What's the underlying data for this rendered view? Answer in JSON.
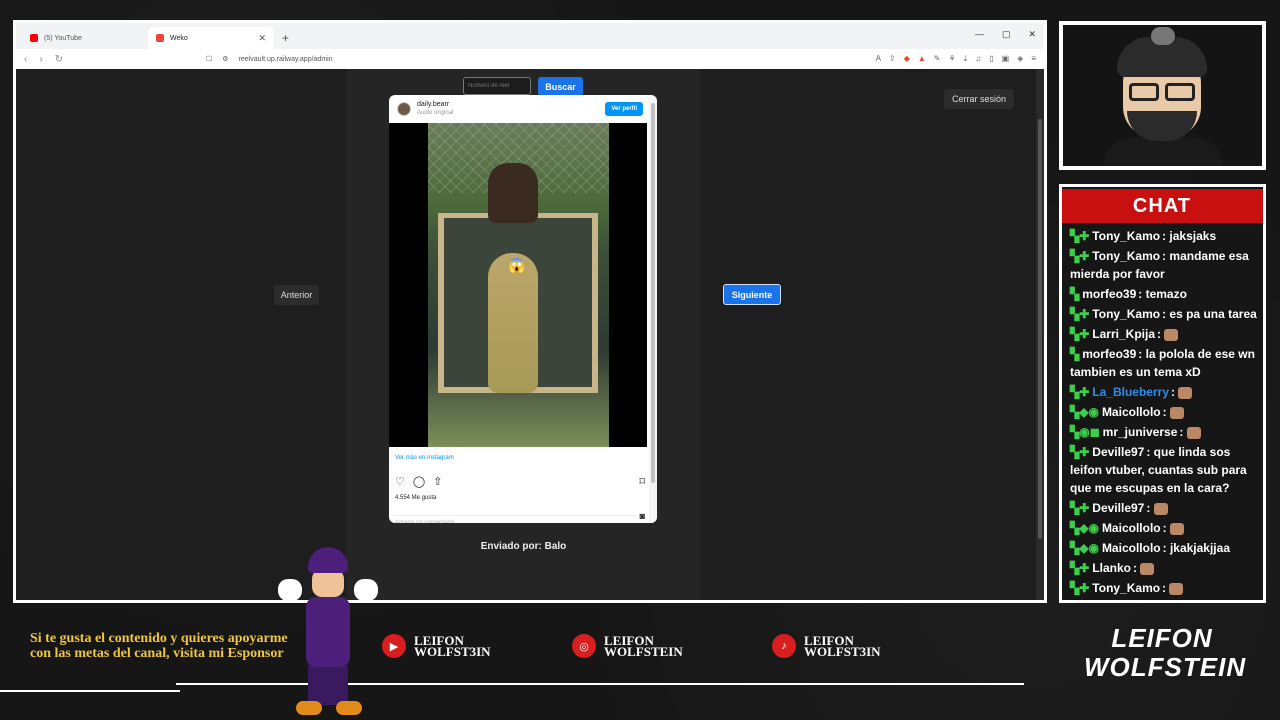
{
  "browser": {
    "tabs": [
      {
        "label": "(5) YouTube",
        "icon": "youtube-icon",
        "color": "#ff0000"
      },
      {
        "label": "Weko",
        "icon": "weko-icon",
        "color": "#e44"
      }
    ],
    "url": "reelvault.up.railway.app/admin"
  },
  "app": {
    "reel_input_placeholder": "Número de reel",
    "search_label": "Buscar",
    "logout_label": "Cerrar sesión",
    "prev_label": "Anterior",
    "next_label": "Siguiente",
    "sent_by": "Enviado por: Balo"
  },
  "instagram": {
    "username": "daily.bearr",
    "subtitle": "Audio original",
    "view_profile": "Ver perfil",
    "view_more": "Ver más en Instagram",
    "likes": "4.554 Me gusta",
    "comment_placeholder": "Agrega un comentario..."
  },
  "chat": {
    "title": "CHAT",
    "messages": [
      {
        "user": "Tony_Kamo",
        "color": "#3dcf4b",
        "text": ": jaksjaks"
      },
      {
        "user": "Tony_Kamo",
        "color": "#3dcf4b",
        "text": ": mandame esa mierda por favor"
      },
      {
        "user": "morfeo39",
        "color": "#3dcf4b",
        "text": ": temazo"
      },
      {
        "user": "Tony_Kamo",
        "color": "#3dcf4b",
        "text": ": es pa una tarea"
      },
      {
        "user": "Larri_Kpija",
        "color": "#3dcf4b",
        "text": ":"
      },
      {
        "user": "morfeo39",
        "color": "#3dcf4b",
        "text": ": la polola de ese wn tambien es un tema xD"
      },
      {
        "user": "La_Blueberry",
        "color": "#2e8ce6",
        "text": ":"
      },
      {
        "user": "Maicollolo",
        "color": "#3dcf4b",
        "text": ":"
      },
      {
        "user": "mr_juniverse",
        "color": "#3dcf4b",
        "text": ":"
      },
      {
        "user": "Deville97",
        "color": "#3dcf4b",
        "text": ": que linda sos leifon vtuber, cuantas sub para que me escupas en la cara?"
      },
      {
        "user": "Deville97",
        "color": "#3dcf4b",
        "text": ":"
      },
      {
        "user": "Maicollolo",
        "color": "#3dcf4b",
        "text": ":"
      },
      {
        "user": "Maicollolo",
        "color": "#3dcf4b",
        "text": ": jkakjakjjaa"
      },
      {
        "user": "Llanko",
        "color": "#3dcf4b",
        "text": ":"
      },
      {
        "user": "Tony_Kamo",
        "color": "#3dcf4b",
        "text": ":"
      }
    ]
  },
  "overlay": {
    "sponsor_text": "Si te gusta el contenido y quieres apoyarme con las metas del canal, visita mi Esponsor",
    "socials": [
      {
        "icon": "youtube-icon",
        "line1": "LEIFON",
        "line2": "WOLFST3IN"
      },
      {
        "icon": "instagram-icon",
        "line1": "LEIFON",
        "line2": "WOLFSTEIN"
      },
      {
        "icon": "tiktok-icon",
        "line1": "LEIFON",
        "line2": "WOLFST3IN"
      }
    ],
    "logo_line1": "LEIFON",
    "logo_line2": "WOLFSTEIN"
  }
}
